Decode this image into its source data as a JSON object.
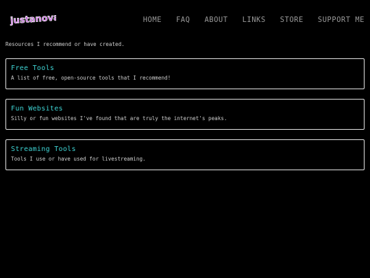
{
  "header": {
    "logo_text": "justanoval",
    "nav": [
      {
        "label": "HOME"
      },
      {
        "label": "FAQ"
      },
      {
        "label": "ABOUT"
      },
      {
        "label": "LINKS"
      },
      {
        "label": "STORE"
      },
      {
        "label": "SUPPORT ME"
      }
    ]
  },
  "intro": "Resources I recommend or have created.",
  "cards": [
    {
      "title": "Free Tools",
      "description": "A list of free, open-source tools that I recommend!"
    },
    {
      "title": "Fun Websites",
      "description": "Silly or fun websites I've found that are truly the internet's peaks."
    },
    {
      "title": "Streaming Tools",
      "description": "Tools I use or have used for livestreaming."
    }
  ],
  "colors": {
    "background": "#000000",
    "nav_text": "#9a9a9a",
    "card_title": "#3fd4d4",
    "card_border": "#e6e6e6",
    "logo_fill": "#c060d8"
  }
}
